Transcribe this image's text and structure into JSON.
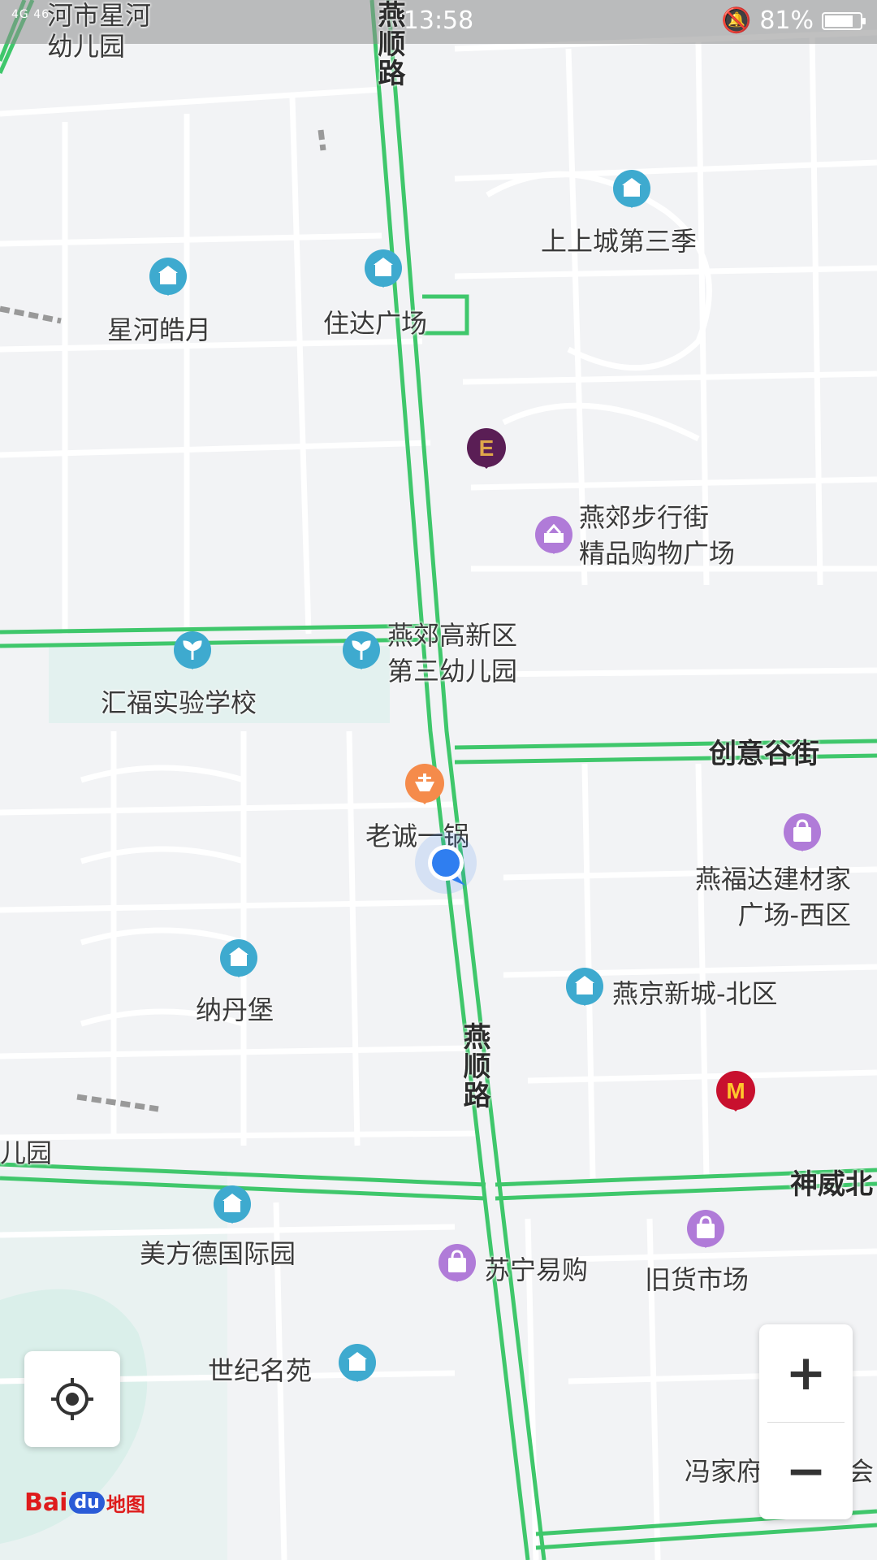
{
  "status_bar": {
    "signal_text": "4G 46",
    "time": "13:58",
    "battery_percent": "81%",
    "battery_level": 0.81
  },
  "places": {
    "xinghe_kindergarten": "河市星河\n幼儿园",
    "shangshangcheng": "上上城第三季",
    "xinghe_haoyue": "星河皓月",
    "zhuda_plaza": "住达广场",
    "yanjiao_walkstreet": "燕郊步行街\n精品购物广场",
    "yanjiao_kindergarten": "燕郊高新区\n第三幼儿园",
    "huifu_school": "汇福实验学校",
    "laocheng_yiguo": "老诚一锅",
    "yanfuda": "燕福达建材家\n广场-西区",
    "yanjing_xincheng": "燕京新城-北区",
    "nadanbao": "纳丹堡",
    "left_edge_park": "儿园",
    "meifangde": "美方德国际园",
    "suning": "苏宁易购",
    "jiuhuo_market": "旧货市场",
    "shiji_mingyuan": "世纪名苑",
    "fengjia": "冯家府",
    "fengjia_tail": "会"
  },
  "roads": {
    "yanshun_top": "燕顺路",
    "yanshun_mid": "燕顺路",
    "chuangyi_valley": "创意谷街",
    "shenwei_north": "神威北"
  },
  "controls": {
    "zoom_in": "+",
    "zoom_out": "−"
  },
  "logo": {
    "bai": "Bai",
    "du": "du",
    "ditu": "地图"
  },
  "colors": {
    "road_green": "#3fc76b",
    "map_bg": "#f2f3f5",
    "poi_blue": "#3eaacf",
    "poi_purple": "#b07bd8",
    "poi_orange": "#f58b4b",
    "mcdonalds_red": "#c8102e",
    "user_dot": "#2f7ef0"
  }
}
